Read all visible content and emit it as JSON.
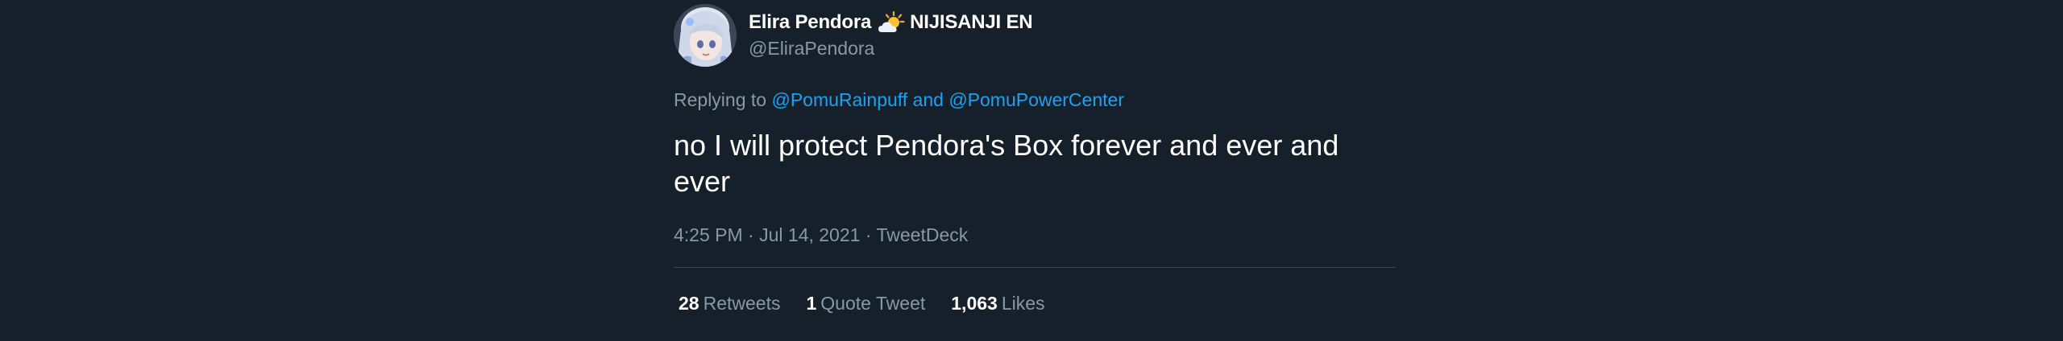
{
  "author": {
    "display_name": "Elira Pendora",
    "affiliation": "NIJISANJI EN",
    "handle": "@EliraPendora",
    "badge_icon": "sun-behind-cloud-icon"
  },
  "reply": {
    "prefix": "Replying to",
    "user1": "@PomuRainpuff",
    "conjunction": "and",
    "user2": "@PomuPowerCenter"
  },
  "tweet": {
    "text": "no I will protect Pendora's Box forever and ever and ever"
  },
  "meta": {
    "time": "4:25 PM",
    "date": "Jul 14, 2021",
    "source": "TweetDeck",
    "separator": "·"
  },
  "stats": {
    "retweets_count": "28",
    "retweets_label": "Retweets",
    "quotes_count": "1",
    "quotes_label": "Quote Tweet",
    "likes_count": "1,063",
    "likes_label": "Likes"
  },
  "colors": {
    "background": "#15202b",
    "text_primary": "#ffffff",
    "text_secondary": "#8899a6",
    "link": "#1da1f2",
    "divider": "#38444d"
  }
}
